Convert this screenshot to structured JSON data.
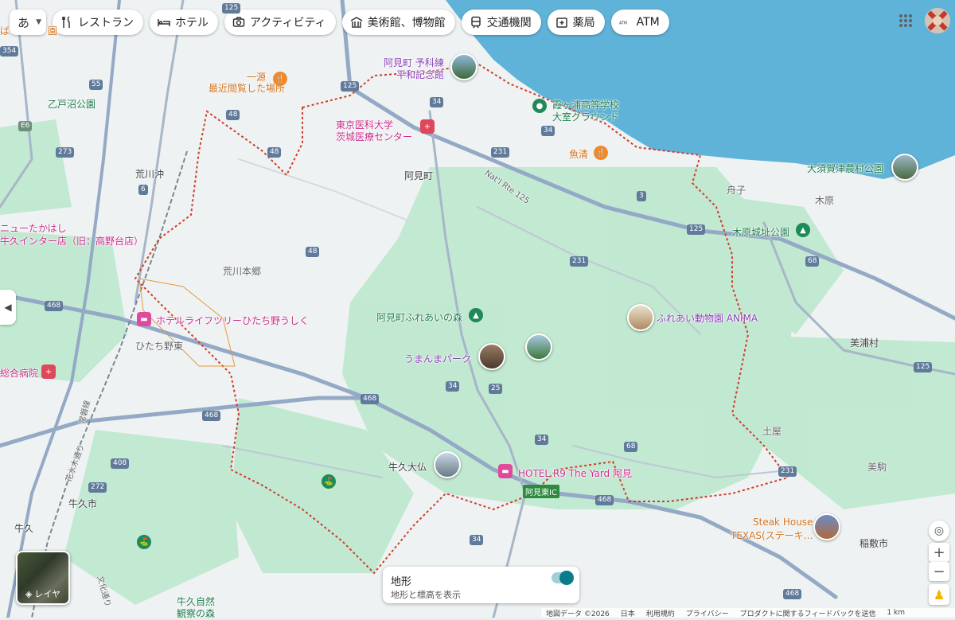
{
  "topbar": {
    "language": "あ",
    "chips": [
      {
        "label": "レストラン",
        "icon": "fork-knife-icon"
      },
      {
        "label": "ホテル",
        "icon": "bed-icon"
      },
      {
        "label": "アクティビティ",
        "icon": "camera-icon"
      },
      {
        "label": "美術館、博物館",
        "icon": "museum-icon"
      },
      {
        "label": "交通機関",
        "icon": "train-icon"
      },
      {
        "label": "薬局",
        "icon": "pharmacy-icon"
      },
      {
        "label": "ATM",
        "icon": "atm-icon"
      }
    ]
  },
  "map_labels": {
    "ami_machi": "阿見町",
    "yokaren_1": "阿見町 予科練",
    "yokaren_2": "平和記念館",
    "kasumigaura_1": "霞ヶ浦高等学校",
    "kasumigaura_2": "大室グラウンド",
    "tokyo_ika_1": "東京医科大学",
    "tokyo_ika_2": "茨城医療センター",
    "ichigen_1": "一源",
    "ichigen_2": "最近閲覧した場所",
    "uosei": "魚清",
    "osuga": "大須賀津農村公園",
    "funako": "舟子",
    "kihara": "木原",
    "kihara_park": "木原城址公園",
    "arakawaoki": "荒川沖",
    "arakawa_hongo": "荒川本郷",
    "otodo": "乙戸沼公園",
    "new_takahashi_1": "ニューたかはし",
    "new_takahashi_2": "牛久インター店（旧：高野台店）",
    "fureai_mori": "阿見町ふれあいの森",
    "umanma": "うまんまパーク",
    "fureai_zoo": "ふれあい動物園 ANIMA",
    "miho": "美浦村",
    "hotel_lifetree": "ホテルライフツリーひたち野うしく",
    "hitachino": "ひたち野東",
    "hospital": "総合病院",
    "ushiku_daibutsu": "牛久大仏",
    "hotel_r9": "HOTEL R9 The Yard 阿見",
    "ami_higashi_ic": "阿見東IC",
    "tsuchiya": "土屋",
    "mikoma": "美駒",
    "steak_1": "Steak House",
    "steak_2": "TEXAS(ステーキ…",
    "inashiki": "稲敷市",
    "ushiku": "牛久市",
    "ushiku2": "牛久",
    "ushiku_shizen_1": "牛久自然",
    "ushiku_shizen_2": "観察の森",
    "jobanline": "常磐線",
    "hanamizuki": "花水木通り",
    "bunka": "文化通り",
    "nat_rte": "Nat'l Rte 125",
    "ba": "ば",
    "en": "園"
  },
  "route_shields": [
    "125",
    "354",
    "55",
    "E6",
    "273",
    "48",
    "6",
    "34",
    "231",
    "468",
    "25",
    "408",
    "272",
    "68",
    "3"
  ],
  "layer_button": {
    "label": "レイヤ"
  },
  "terrain_popup": {
    "title": "地形",
    "subtitle": "地形と標高を表示",
    "enabled": true
  },
  "footer": {
    "items": [
      "地図データ ©2026",
      "日本",
      "利用規約",
      "プライバシー",
      "プロダクトに関するフィードバックを送信"
    ],
    "scale": "1 km"
  },
  "colors": {
    "water": "#5fb3d9",
    "land": "#eef2f2",
    "terrain_green": "#b9e6cc",
    "boundary": "#d23b2b",
    "highway": "#8ea4bf"
  }
}
